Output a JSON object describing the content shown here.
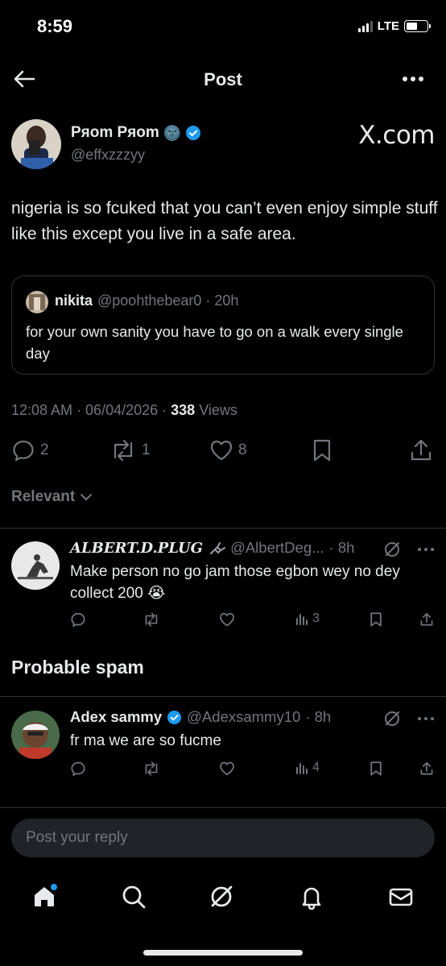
{
  "status": {
    "time": "8:59",
    "network": "LTE"
  },
  "header": {
    "title": "Post"
  },
  "post": {
    "author_name": "Pяom Pяom",
    "author_emoji": "🌚",
    "author_handle": "@effxzzzyy",
    "watermark": "X.com",
    "text": "nigeria is so fcuked that you can’t even enjoy simple stuff like this except you live in a safe area.",
    "quote": {
      "name": "nikita",
      "handle": "@poohthebear0 · 20h",
      "text": "for your own sanity you have to go on a walk every single day"
    },
    "time_date": "12:08 AM · 06/04/2026 · ",
    "views_count": "338",
    "views_label": " Views",
    "replies": "2",
    "reposts": "1",
    "likes": "8"
  },
  "sort": {
    "label": "Relevant"
  },
  "replies": [
    {
      "name": "ALBERT.D.PLUG",
      "handle": "@AlbertDeg...",
      "time": "· 8h",
      "text": "Make person no go jam those egbon wey no dey collect 200 😭",
      "views": "3"
    },
    {
      "name": "Adex sammy",
      "handle": "@Adexsammy10",
      "time": "· 8h",
      "text": "fr ma we are so fucme",
      "views": "4"
    }
  ],
  "spam_section": {
    "title": "Probable spam"
  },
  "compose": {
    "placeholder": "Post your reply"
  },
  "colors": {
    "background": "#000000",
    "text": "#e7e9ea",
    "muted": "#71767b",
    "accent": "#1d9bf0",
    "border": "#2f3336"
  }
}
